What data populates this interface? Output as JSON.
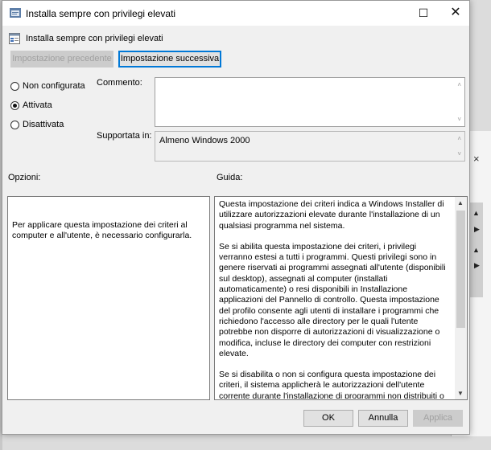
{
  "window": {
    "title": "Installa sempre con privilegi elevati",
    "min_glyph": "—",
    "max_glyph": "☐",
    "close_glyph": "✕"
  },
  "header": {
    "setting_title": "Installa sempre con privilegi elevati"
  },
  "nav": {
    "prev_label": "Impostazione precedente",
    "next_label": "Impostazione successiva"
  },
  "state": {
    "options": [
      "Non configurata",
      "Attivata",
      "Disattivata"
    ],
    "selected": "Attivata"
  },
  "comment": {
    "label": "Commento:",
    "value": ""
  },
  "supported": {
    "label": "Supportata in:",
    "value": "Almeno Windows 2000"
  },
  "options_section": {
    "label": "Opzioni:",
    "text": "Per applicare questa impostazione dei criteri al computer e all'utente, è necessario configurarla."
  },
  "help_section": {
    "label": "Guida:",
    "paragraphs": [
      "Questa impostazione dei criteri indica a Windows Installer di utilizzare autorizzazioni elevate durante l'installazione di un qualsiasi programma nel sistema.",
      "Se si abilita questa impostazione dei criteri, i privilegi verranno estesi a tutti i programmi. Questi privilegi sono in genere riservati ai programmi assegnati all'utente (disponibili sul desktop), assegnati al computer (installati automaticamente) o resi disponibili in Installazione applicazioni del Pannello di controllo. Questa impostazione del profilo consente agli utenti di installare i programmi che richiedono l'accesso alle directory per le quali l'utente potrebbe non disporre di autorizzazioni di visualizzazione o modifica, incluse le directory dei computer con restrizioni elevate.",
      "Se si disabilita o non si configura questa impostazione dei criteri, il sistema applicherà le autorizzazioni dell'utente corrente durante l'installazione di programmi non distribuiti o resi disponibili da un amministratore di sistema."
    ]
  },
  "footer": {
    "ok_label": "OK",
    "cancel_label": "Annulla",
    "apply_label": "Applica"
  },
  "background": {
    "close_glyph": "×"
  },
  "colors": {
    "focus": "#0078d7",
    "dialog_bg": "#f0f0f0",
    "disabled_text": "#a0a0a0"
  }
}
